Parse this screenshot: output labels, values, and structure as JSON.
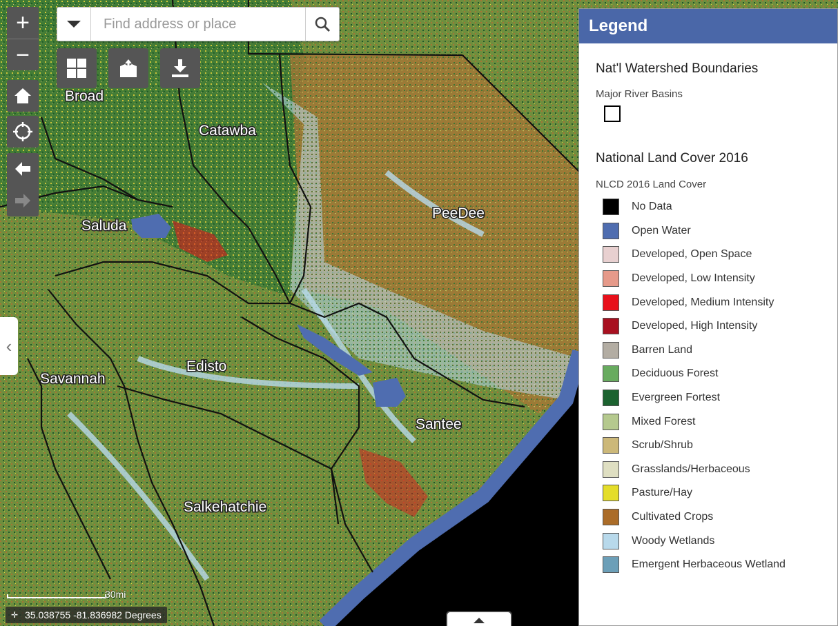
{
  "search": {
    "placeholder": "Find address or place"
  },
  "map_labels": [
    "Broad",
    "Catawba",
    "PeeDee",
    "Saluda",
    "Edisto",
    "Savannah",
    "Santee",
    "Salkehatchie"
  ],
  "widgets": [
    "grid-icon",
    "upload-icon",
    "download-icon"
  ],
  "scale": {
    "label": "30mi"
  },
  "coordinates": {
    "text": "35.038755 -81.836982 Degrees"
  },
  "legend": {
    "title": "Legend",
    "layer1": {
      "title": "Nat'l Watershed Boundaries",
      "subtitle": "Major River Basins"
    },
    "layer2": {
      "title": "National Land Cover 2016",
      "subtitle": "NLCD 2016 Land Cover"
    },
    "items": [
      {
        "label": "No Data",
        "color": "#000000"
      },
      {
        "label": "Open Water",
        "color": "#4f6db0"
      },
      {
        "label": "Developed, Open Space",
        "color": "#e8d0d0"
      },
      {
        "label": "Developed, Low Intensity",
        "color": "#e69a8a"
      },
      {
        "label": "Developed, Medium Intensity",
        "color": "#e8101a"
      },
      {
        "label": "Developed, High Intensity",
        "color": "#a81020"
      },
      {
        "label": "Barren Land",
        "color": "#b3ada3"
      },
      {
        "label": "Deciduous Forest",
        "color": "#68ab5f"
      },
      {
        "label": "Evergreen Fortest",
        "color": "#1c6330"
      },
      {
        "label": "Mixed Forest",
        "color": "#b5c98e"
      },
      {
        "label": "Scrub/Shrub",
        "color": "#ccb879"
      },
      {
        "label": "Grasslands/Herbaceous",
        "color": "#dfdfc2"
      },
      {
        "label": "Pasture/Hay",
        "color": "#e4dd2a"
      },
      {
        "label": "Cultivated Crops",
        "color": "#ab6c28"
      },
      {
        "label": "Woody Wetlands",
        "color": "#b8d9eb"
      },
      {
        "label": "Emergent Herbaceous Wetland",
        "color": "#6c9fb8"
      }
    ]
  }
}
